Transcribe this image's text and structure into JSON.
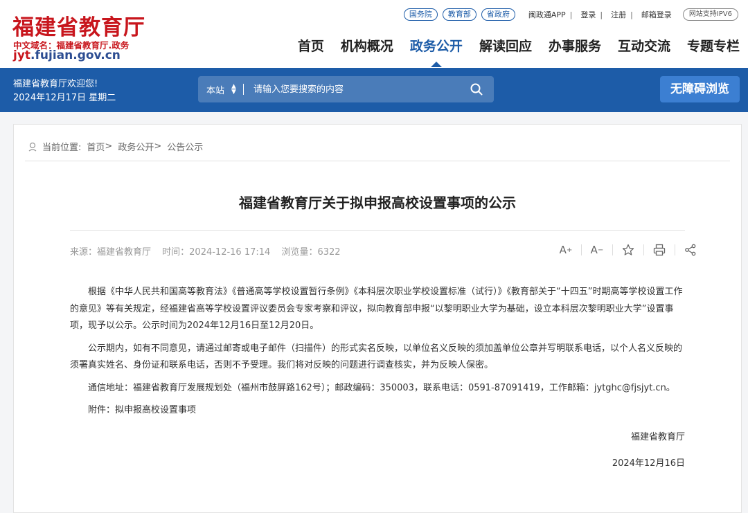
{
  "header": {
    "logo_title": "福建省教育厅",
    "logo_cn_domain": "中文域名：福建省教育厅.政务",
    "logo_domain_main": "jyt",
    "logo_domain_rest": ".fujian.gov.cn",
    "top_pills": [
      "国务院",
      "教育部",
      "省政府"
    ],
    "top_links": [
      "闽政通APP",
      "登录",
      "注册",
      "邮箱登录"
    ],
    "ipv6": "网站支持IPV6",
    "nav": [
      {
        "label": "首页",
        "active": false
      },
      {
        "label": "机构概况",
        "active": false
      },
      {
        "label": "政务公开",
        "active": true
      },
      {
        "label": "解读回应",
        "active": false
      },
      {
        "label": "办事服务",
        "active": false
      },
      {
        "label": "互动交流",
        "active": false
      },
      {
        "label": "专题专栏",
        "active": false
      }
    ]
  },
  "band": {
    "welcome": "福建省教育厅欢迎您!",
    "date": "2024年12月17日 星期二",
    "search_scope": "本站",
    "search_placeholder": "请输入您要搜索的内容",
    "accessibility": "无障碍浏览"
  },
  "breadcrumb": {
    "label": "当前位置:",
    "items": [
      "首页",
      "政务公开",
      "公告公示"
    ],
    "separator": ">"
  },
  "article": {
    "title": "福建省教育厅关于拟申报高校设置事项的公示",
    "source": "来源：福建省教育厅",
    "time": "时间：2024-12-16 17:14",
    "views": "浏览量：6322",
    "paragraphs": [
      "根据《中华人民共和国高等教育法》《普通高等学校设置暂行条例》《本科层次职业学校设置标准（试行）》《教育部关于“十四五”时期高等学校设置工作的意见》等有关规定，经福建省高等学校设置评议委员会专家考察和评议，拟向教育部申报“以黎明职业大学为基础，设立本科层次黎明职业大学”设置事项，现予以公示。公示时间为2024年12月16日至12月20日。",
      "公示期内，如有不同意见，请通过邮寄或电子邮件（扫描件）的形式实名反映，以单位名义反映的须加盖单位公章并写明联系电话，以个人名义反映的须署真实姓名、身份证和联系电话，否则不予受理。我们将对反映的问题进行调查核实，并为反映人保密。",
      "通信地址：福建省教育厅发展规划处（福州市鼓屏路162号）；邮政编码：350003，联系电话：0591-87091419，工作邮箱：jytghc@fjsjyt.cn。",
      "附件：拟申报高校设置事项"
    ],
    "signature": "福建省教育厅",
    "sign_date": "2024年12月16日"
  },
  "colors": {
    "brand_red": "#c8161d",
    "brand_blue": "#1d5ca8"
  }
}
